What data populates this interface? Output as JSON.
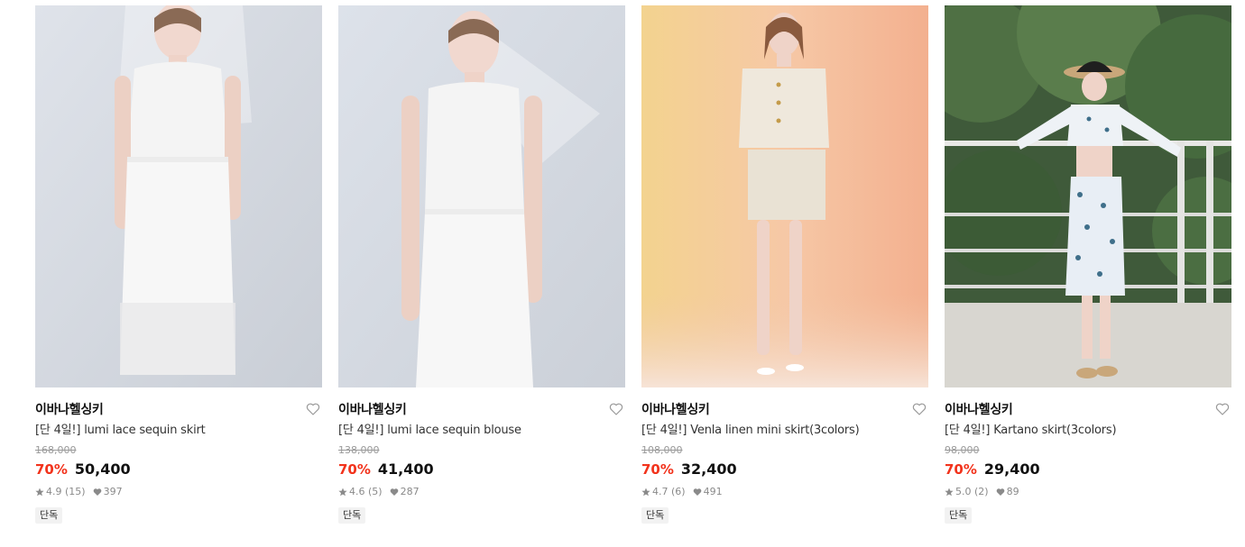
{
  "products": [
    {
      "brand": "이바나헬싱키",
      "name": "[단 4일!] lumi lace sequin skirt",
      "original_price": "168,000",
      "discount": "70%",
      "price": "50,400",
      "rating": "4.9",
      "reviews": "(15)",
      "likes": "397",
      "badge": "단독"
    },
    {
      "brand": "이바나헬싱키",
      "name": "[단 4일!] lumi lace sequin blouse",
      "original_price": "138,000",
      "discount": "70%",
      "price": "41,400",
      "rating": "4.6",
      "reviews": "(5)",
      "likes": "287",
      "badge": "단독"
    },
    {
      "brand": "이바나헬싱키",
      "name": "[단 4일!] Venla linen mini skirt(3colors)",
      "original_price": "108,000",
      "discount": "70%",
      "price": "32,400",
      "rating": "4.7",
      "reviews": "(6)",
      "likes": "491",
      "badge": "단독"
    },
    {
      "brand": "이바나헬싱키",
      "name": "[단 4일!] Kartano skirt(3colors)",
      "original_price": "98,000",
      "discount": "70%",
      "price": "29,400",
      "rating": "5.0",
      "reviews": "(2)",
      "likes": "89",
      "badge": "단독"
    }
  ],
  "colors": {
    "discount": "#f2331c",
    "muted": "#8a8a8a",
    "badge_bg": "#f2f2f2"
  },
  "icons": [
    "heart-icon",
    "star-icon",
    "like-icon"
  ]
}
